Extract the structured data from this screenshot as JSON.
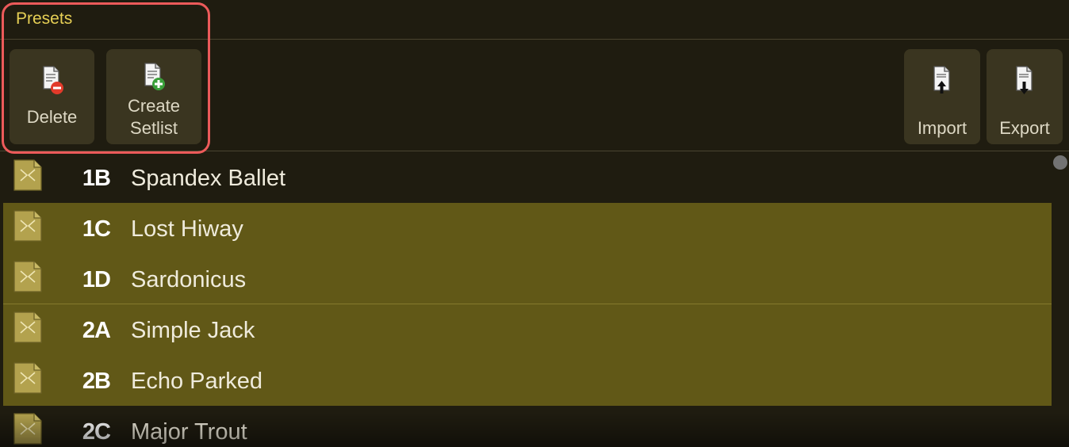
{
  "header": {
    "title": "Presets"
  },
  "toolbar": {
    "delete_label": "Delete",
    "create_setlist_line1": "Create",
    "create_setlist_line2": "Setlist",
    "import_label": "Import",
    "export_label": "Export"
  },
  "presets": [
    {
      "code": "1B",
      "name": "Spandex Ballet",
      "selected": false
    },
    {
      "code": "1C",
      "name": "Lost Hiway",
      "selected": true
    },
    {
      "code": "1D",
      "name": "Sardonicus",
      "selected": true
    },
    {
      "code": "2A",
      "name": "Simple Jack",
      "selected": true
    },
    {
      "code": "2B",
      "name": "Echo Parked",
      "selected": true
    },
    {
      "code": "2C",
      "name": "Major Trout",
      "selected": false
    }
  ],
  "colors": {
    "accent": "#e6cf55",
    "selection": "#615817",
    "highlight": "#ec5a5a"
  }
}
